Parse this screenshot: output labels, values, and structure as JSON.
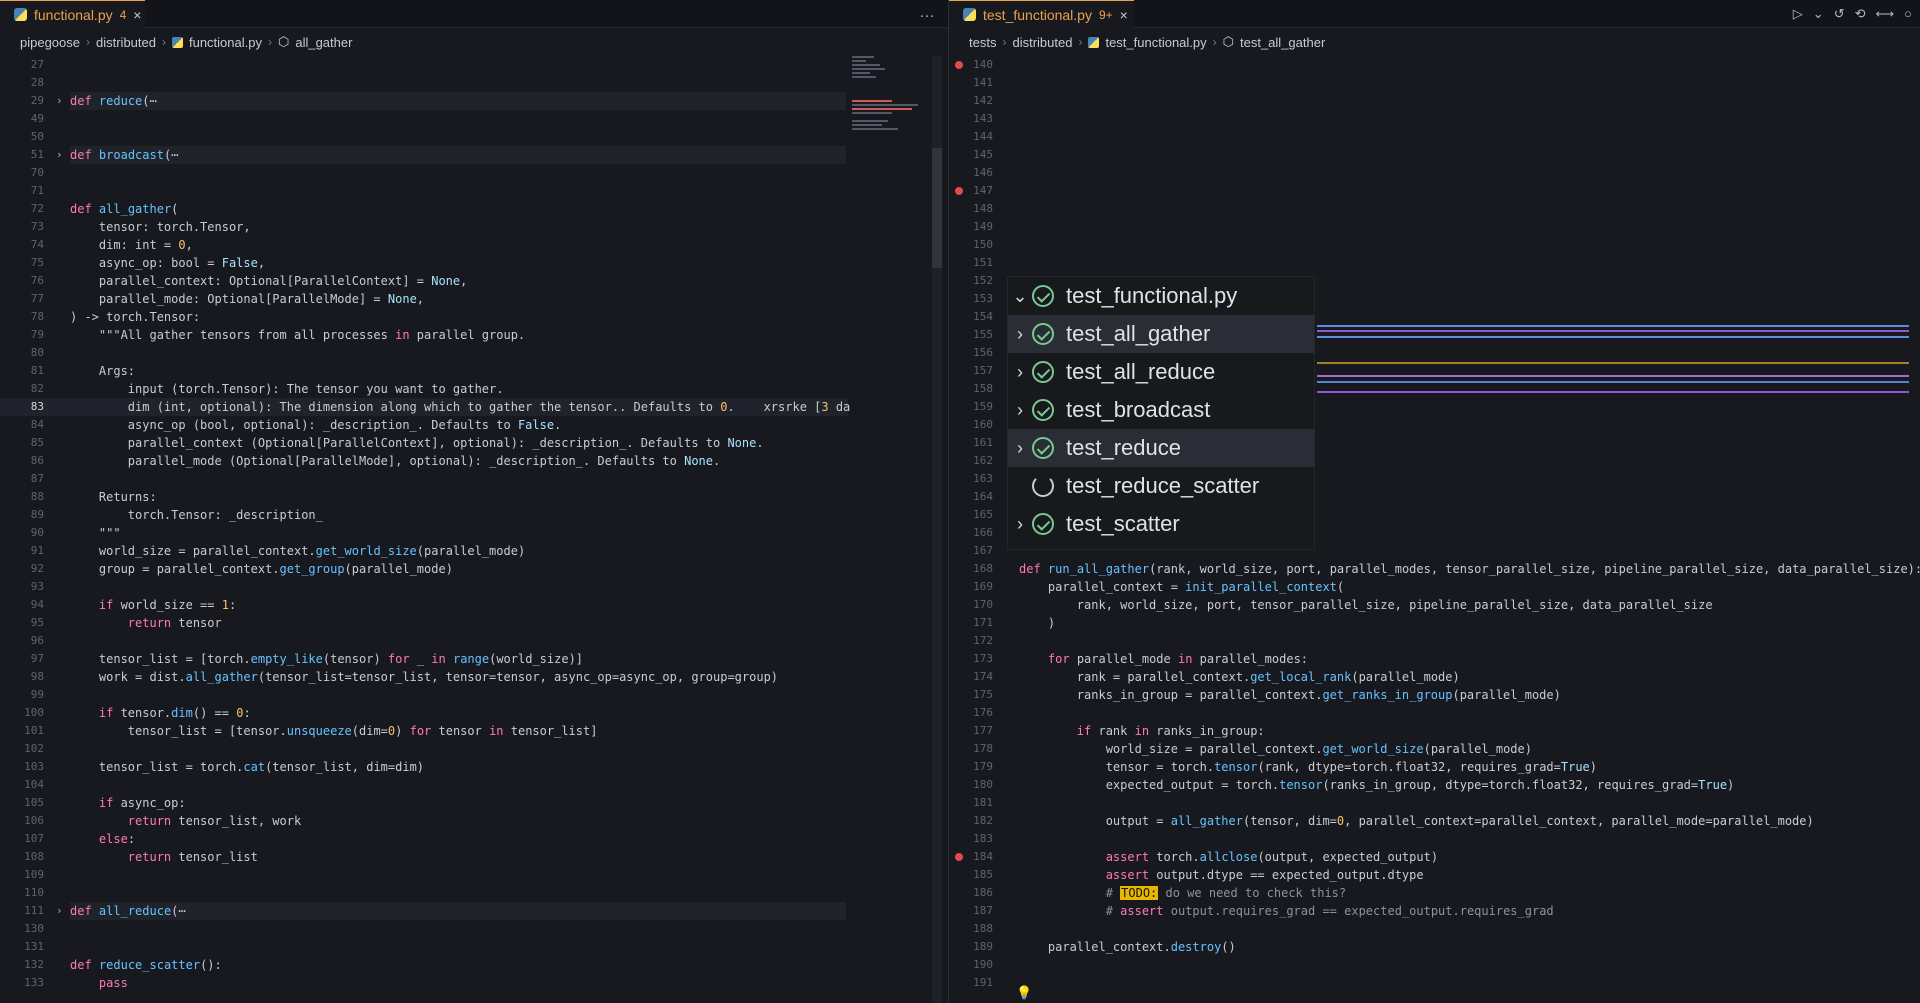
{
  "left": {
    "tab": {
      "title": "functional.py",
      "count": "4"
    },
    "breadcrumbs": [
      "pipegoose",
      "distributed",
      "functional.py",
      "all_gather"
    ],
    "lines": [
      {
        "n": "27",
        "t": ""
      },
      {
        "n": "28",
        "t": ""
      },
      {
        "n": "29",
        "t": "def reduce(⋯"
      },
      {
        "n": "49",
        "t": ""
      },
      {
        "n": "50",
        "t": ""
      },
      {
        "n": "51",
        "t": "def broadcast(⋯"
      },
      {
        "n": "70",
        "t": ""
      },
      {
        "n": "71",
        "t": ""
      },
      {
        "n": "72",
        "t": "def all_gather("
      },
      {
        "n": "73",
        "t": "    tensor: torch.Tensor,"
      },
      {
        "n": "74",
        "t": "    dim: int = 0,"
      },
      {
        "n": "75",
        "t": "    async_op: bool = False,"
      },
      {
        "n": "76",
        "t": "    parallel_context: Optional[ParallelContext] = None,"
      },
      {
        "n": "77",
        "t": "    parallel_mode: Optional[ParallelMode] = None,"
      },
      {
        "n": "78",
        "t": ") -> torch.Tensor:"
      },
      {
        "n": "79",
        "t": "    \"\"\"All gather tensors from all processes in parallel group."
      },
      {
        "n": "80",
        "t": ""
      },
      {
        "n": "81",
        "t": "    Args:"
      },
      {
        "n": "82",
        "t": "        input (torch.Tensor): The tensor you want to gather."
      },
      {
        "n": "83",
        "t": "        dim (int, optional): The dimension along which to gather the tensor.. Defaults to 0.    xrsrke [3 da"
      },
      {
        "n": "84",
        "t": "        async_op (bool, optional): _description_. Defaults to False."
      },
      {
        "n": "85",
        "t": "        parallel_context (Optional[ParallelContext], optional): _description_. Defaults to None."
      },
      {
        "n": "86",
        "t": "        parallel_mode (Optional[ParallelMode], optional): _description_. Defaults to None."
      },
      {
        "n": "87",
        "t": ""
      },
      {
        "n": "88",
        "t": "    Returns:"
      },
      {
        "n": "89",
        "t": "        torch.Tensor: _description_"
      },
      {
        "n": "90",
        "t": "    \"\"\""
      },
      {
        "n": "91",
        "t": "    world_size = parallel_context.get_world_size(parallel_mode)"
      },
      {
        "n": "92",
        "t": "    group = parallel_context.get_group(parallel_mode)"
      },
      {
        "n": "93",
        "t": ""
      },
      {
        "n": "94",
        "t": "    if world_size == 1:"
      },
      {
        "n": "95",
        "t": "        return tensor"
      },
      {
        "n": "96",
        "t": ""
      },
      {
        "n": "97",
        "t": "    tensor_list = [torch.empty_like(tensor) for _ in range(world_size)]"
      },
      {
        "n": "98",
        "t": "    work = dist.all_gather(tensor_list=tensor_list, tensor=tensor, async_op=async_op, group=group)"
      },
      {
        "n": "99",
        "t": ""
      },
      {
        "n": "100",
        "t": "    if tensor.dim() == 0:"
      },
      {
        "n": "101",
        "t": "        tensor_list = [tensor.unsqueeze(dim=0) for tensor in tensor_list]"
      },
      {
        "n": "102",
        "t": ""
      },
      {
        "n": "103",
        "t": "    tensor_list = torch.cat(tensor_list, dim=dim)"
      },
      {
        "n": "104",
        "t": ""
      },
      {
        "n": "105",
        "t": "    if async_op:"
      },
      {
        "n": "106",
        "t": "        return tensor_list, work"
      },
      {
        "n": "107",
        "t": "    else:"
      },
      {
        "n": "108",
        "t": "        return tensor_list"
      },
      {
        "n": "109",
        "t": ""
      },
      {
        "n": "110",
        "t": ""
      },
      {
        "n": "111",
        "t": "def all_reduce(⋯"
      },
      {
        "n": "130",
        "t": ""
      },
      {
        "n": "131",
        "t": ""
      },
      {
        "n": "132",
        "t": "def reduce_scatter():"
      },
      {
        "n": "133",
        "t": "    pass"
      }
    ]
  },
  "right": {
    "tab": {
      "title": "test_functional.py",
      "count": "9+"
    },
    "breadcrumbs": [
      "tests",
      "distributed",
      "test_functional.py",
      "test_all_gather"
    ],
    "tree": {
      "root": "test_functional.py",
      "items": [
        "test_all_gather",
        "test_all_reduce",
        "test_broadcast",
        "test_reduce",
        "test_reduce_scatter",
        "test_scatter"
      ]
    },
    "lines": [
      {
        "n": "140",
        "t": ""
      },
      {
        "n": "141",
        "t": ""
      },
      {
        "n": "142",
        "t": ""
      },
      {
        "n": "143",
        "t": ""
      },
      {
        "n": "144",
        "t": ""
      },
      {
        "n": "145",
        "t": ""
      },
      {
        "n": "146",
        "t": ""
      },
      {
        "n": "147",
        "t": ""
      },
      {
        "n": "148",
        "t": ""
      },
      {
        "n": "149",
        "t": ""
      },
      {
        "n": "150",
        "t": ""
      },
      {
        "n": "151",
        "t": ""
      },
      {
        "n": "152",
        "t": ""
      },
      {
        "n": "153",
        "t": ""
      },
      {
        "n": "154",
        "t": ""
      },
      {
        "n": "155",
        "t": ""
      },
      {
        "n": "156",
        "t": ""
      },
      {
        "n": "157",
        "t": ""
      },
      {
        "n": "158",
        "t": ""
      },
      {
        "n": "159",
        "t": ""
      },
      {
        "n": "160",
        "t": ""
      },
      {
        "n": "161",
        "t": ""
      },
      {
        "n": "162",
        "t": ""
      },
      {
        "n": "163",
        "t": ""
      },
      {
        "n": "164",
        "t": ""
      },
      {
        "n": "165",
        "t": ""
      },
      {
        "n": "166",
        "t": ""
      },
      {
        "n": "167",
        "t": ""
      },
      {
        "n": "168",
        "t": "def run_all_gather(rank, world_size, port, parallel_modes, tensor_parallel_size, pipeline_parallel_size, data_parallel_size):"
      },
      {
        "n": "169",
        "t": "    parallel_context = init_parallel_context("
      },
      {
        "n": "170",
        "t": "        rank, world_size, port, tensor_parallel_size, pipeline_parallel_size, data_parallel_size"
      },
      {
        "n": "171",
        "t": "    )"
      },
      {
        "n": "172",
        "t": ""
      },
      {
        "n": "173",
        "t": "    for parallel_mode in parallel_modes:"
      },
      {
        "n": "174",
        "t": "        rank = parallel_context.get_local_rank(parallel_mode)"
      },
      {
        "n": "175",
        "t": "        ranks_in_group = parallel_context.get_ranks_in_group(parallel_mode)"
      },
      {
        "n": "176",
        "t": ""
      },
      {
        "n": "177",
        "t": "        if rank in ranks_in_group:"
      },
      {
        "n": "178",
        "t": "            world_size = parallel_context.get_world_size(parallel_mode)"
      },
      {
        "n": "179",
        "t": "            tensor = torch.tensor(rank, dtype=torch.float32, requires_grad=True)"
      },
      {
        "n": "180",
        "t": "            expected_output = torch.tensor(ranks_in_group, dtype=torch.float32, requires_grad=True)"
      },
      {
        "n": "181",
        "t": ""
      },
      {
        "n": "182",
        "t": "            output = all_gather(tensor, dim=0, parallel_context=parallel_context, parallel_mode=parallel_mode)"
      },
      {
        "n": "183",
        "t": ""
      },
      {
        "n": "184",
        "t": "            assert torch.allclose(output, expected_output)"
      },
      {
        "n": "185",
        "t": "            assert output.dtype == expected_output.dtype"
      },
      {
        "n": "186",
        "t": "            # TODO: do we need to check this?"
      },
      {
        "n": "187",
        "t": "            # assert output.requires_grad == expected_output.requires_grad"
      },
      {
        "n": "188",
        "t": ""
      },
      {
        "n": "189",
        "t": "    parallel_context.destroy()"
      },
      {
        "n": "190",
        "t": ""
      },
      {
        "n": "191",
        "t": ""
      }
    ]
  }
}
